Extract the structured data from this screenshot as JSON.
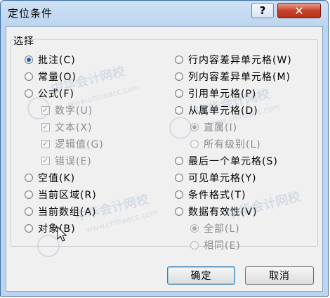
{
  "window": {
    "title": "定位条件"
  },
  "titlebar": {
    "help_label": "?",
    "close_label": "✕"
  },
  "group": {
    "label": "选择"
  },
  "left_options": [
    {
      "label": "批注(C)",
      "kind": "radio",
      "checked": true,
      "disabled": false
    },
    {
      "label": "常量(O)",
      "kind": "radio",
      "checked": false,
      "disabled": false
    },
    {
      "label": "公式(F)",
      "kind": "radio",
      "checked": false,
      "disabled": false
    },
    {
      "label": "数字(U)",
      "kind": "check",
      "checked": true,
      "disabled": true
    },
    {
      "label": "文本(X)",
      "kind": "check",
      "checked": true,
      "disabled": true
    },
    {
      "label": "逻辑值(G)",
      "kind": "check",
      "checked": true,
      "disabled": true
    },
    {
      "label": "错误(E)",
      "kind": "check",
      "checked": true,
      "disabled": true
    },
    {
      "label": "空值(K)",
      "kind": "radio",
      "checked": false,
      "disabled": false
    },
    {
      "label": "当前区域(R)",
      "kind": "radio",
      "checked": false,
      "disabled": false
    },
    {
      "label": "当前数组(A)",
      "kind": "radio",
      "checked": false,
      "disabled": false
    },
    {
      "label": "对象(B)",
      "kind": "radio",
      "checked": false,
      "disabled": false
    }
  ],
  "right_options": [
    {
      "label": "行内容差异单元格(W)",
      "kind": "radio",
      "checked": false,
      "disabled": false
    },
    {
      "label": "列内容差异单元格(M)",
      "kind": "radio",
      "checked": false,
      "disabled": false
    },
    {
      "label": "引用单元格(P)",
      "kind": "radio",
      "checked": false,
      "disabled": false
    },
    {
      "label": "从属单元格(D)",
      "kind": "radio",
      "checked": false,
      "disabled": false
    },
    {
      "label": "直属(I)",
      "kind": "radio",
      "checked": true,
      "disabled": true
    },
    {
      "label": "所有级别(L)",
      "kind": "radio",
      "checked": false,
      "disabled": true
    },
    {
      "label": "最后一个单元格(S)",
      "kind": "radio",
      "checked": false,
      "disabled": false
    },
    {
      "label": "可见单元格(Y)",
      "kind": "radio",
      "checked": false,
      "disabled": false
    },
    {
      "label": "条件格式(T)",
      "kind": "radio",
      "checked": false,
      "disabled": false
    },
    {
      "label": "数据有效性(V)",
      "kind": "radio",
      "checked": false,
      "disabled": false
    },
    {
      "label": "全部(L)",
      "kind": "radio",
      "checked": true,
      "disabled": true
    },
    {
      "label": "相同(E)",
      "kind": "radio",
      "checked": false,
      "disabled": true
    }
  ],
  "buttons": {
    "ok": "确定",
    "cancel": "取消"
  },
  "watermark": {
    "text": "中华会计网校",
    "url": "www.chinaacc.com"
  }
}
